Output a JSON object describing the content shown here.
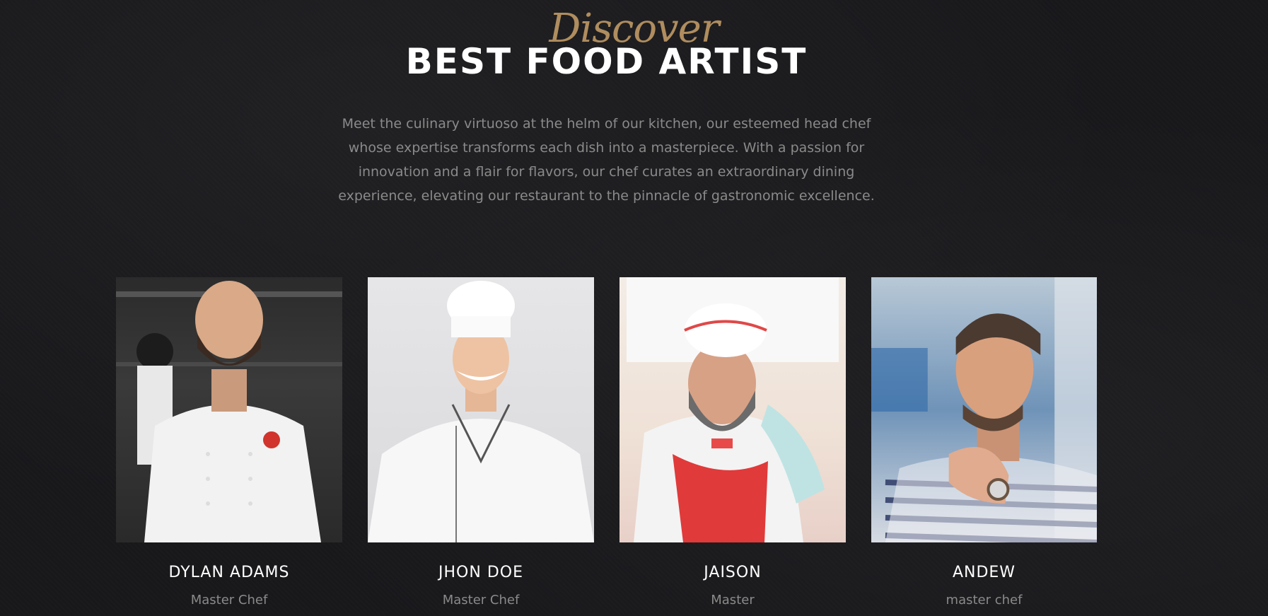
{
  "section": {
    "script_title": "Discover",
    "title": "BEST FOOD ARTIST",
    "intro": "Meet the culinary virtuoso at the helm of our kitchen, our esteemed head chef whose expertise transforms each dish into a masterpiece. With a passion for innovation and a flair for flavors, our chef curates an extraordinary dining experience, elevating our restaurant to the pinnacle of gastronomic excellence."
  },
  "chefs": [
    {
      "name": "DYLAN ADAMS",
      "role": "Master Chef"
    },
    {
      "name": "JHON DOE",
      "role": "Master Chef"
    },
    {
      "name": "JAISON",
      "role": "Master"
    },
    {
      "name": "ANDEW",
      "role": "master chef"
    }
  ],
  "colors": {
    "background": "#18181b",
    "accent": "#b08d5e",
    "title": "#ffffff",
    "muted": "#8a8a8a"
  }
}
